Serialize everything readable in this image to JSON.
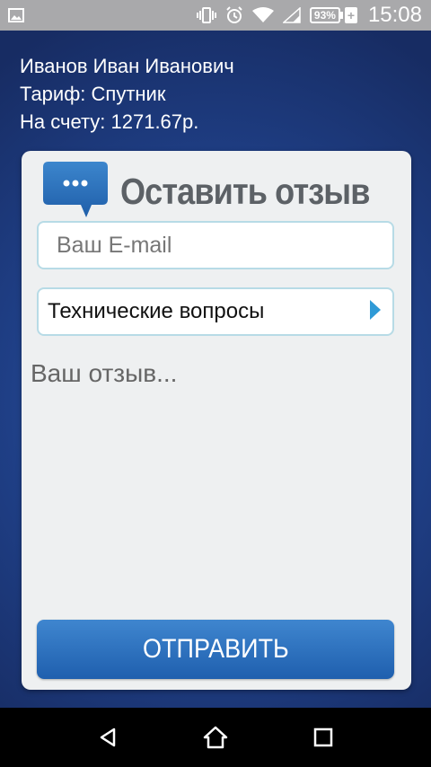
{
  "status_bar": {
    "battery_percent": "93%",
    "time": "15:08",
    "icons": [
      "image-notification-icon",
      "vibrate-icon",
      "alarm-icon",
      "wifi-icon",
      "cell-signal-icon",
      "battery-icon",
      "charging-icon"
    ]
  },
  "account": {
    "name": "Иванов Иван Иванович",
    "tariff": "Тариф: Спутник",
    "balance": "На счету: 1271.67р."
  },
  "feedback": {
    "title": "Оставить отзыв",
    "email_placeholder": "Ваш E-mail",
    "email_value": "",
    "category_selected": "Технические вопросы",
    "review_placeholder": "Ваш отзыв...",
    "review_value": "",
    "submit_label": "ОТПРАВИТЬ"
  },
  "colors": {
    "background": "#1f3f86",
    "card": "#eef0f1",
    "accent": "#2f78c4",
    "title": "#5c6166",
    "field_border": "#b7dbe6"
  },
  "nav": {
    "icons": [
      "back-icon",
      "home-icon",
      "recents-icon"
    ]
  }
}
